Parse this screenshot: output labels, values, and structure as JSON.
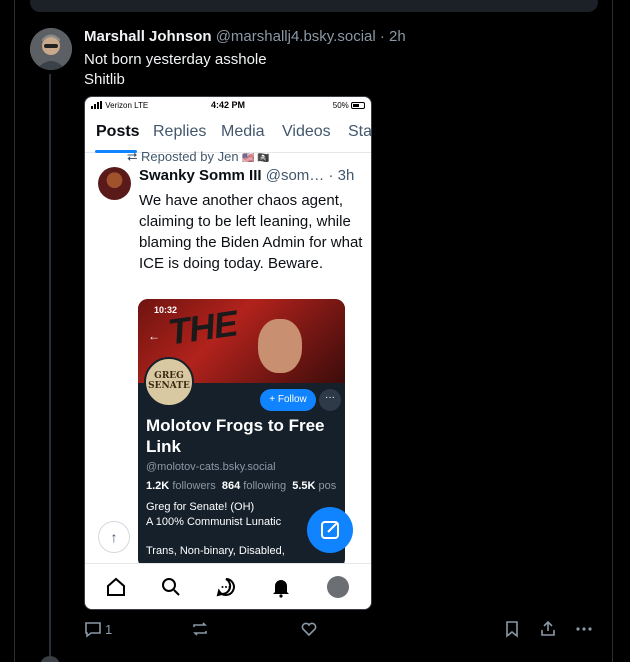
{
  "post": {
    "author_name": "Marshall Johnson",
    "author_handle": "@marshallj4.bsky.social",
    "separator": "·",
    "time": "2h",
    "text_line1": "Not born yesterday asshole",
    "text_line2": "Shitlib",
    "reply_count": "1"
  },
  "screenshot": {
    "status": {
      "carrier": "Verizon  LTE",
      "time": "4:42 PM",
      "battery": "50%"
    },
    "tabs": [
      "Posts",
      "Replies",
      "Media",
      "Videos",
      "Sta"
    ],
    "repost_label": "⮂ Reposted by Jen",
    "repost_emoji": "🇺🇸 🏴‍☠️",
    "inner_post": {
      "name": "Swanky Somm III",
      "handle": "@som…",
      "time": "· 3h",
      "text": "We have another chaos agent, claiming to be left leaning, while blaming the Biden Admin for what ICE is doing today. Beware."
    },
    "card": {
      "time": "10:32",
      "banner_text": "THE",
      "avatar_text": "GREG SENATE",
      "follow_label": "+ Follow",
      "more_label": "···",
      "name": "Molotov Frogs to Free Link",
      "handle": "@molotov-cats.bsky.social",
      "followers_count": "1.2K",
      "followers_label": "followers",
      "following_count": "864",
      "following_label": "following",
      "posts_count": "5.5K",
      "posts_label": "pos",
      "bio1": "Greg for Senate! (OH)",
      "bio2": "A 100% Communist Lunatic",
      "bio3": "Trans, Non-binary, Disabled,"
    }
  },
  "colors": {
    "background": "#000000",
    "accent": "#1083fe",
    "muted_text": "#8b98a5",
    "border": "#2a2f36"
  },
  "icons": [
    "reply-icon",
    "repost-icon",
    "like-icon",
    "bookmark-icon",
    "share-icon",
    "more-icon",
    "home-icon",
    "search-icon",
    "chat-icon",
    "bell-icon",
    "compose-icon",
    "arrow-up-icon"
  ]
}
